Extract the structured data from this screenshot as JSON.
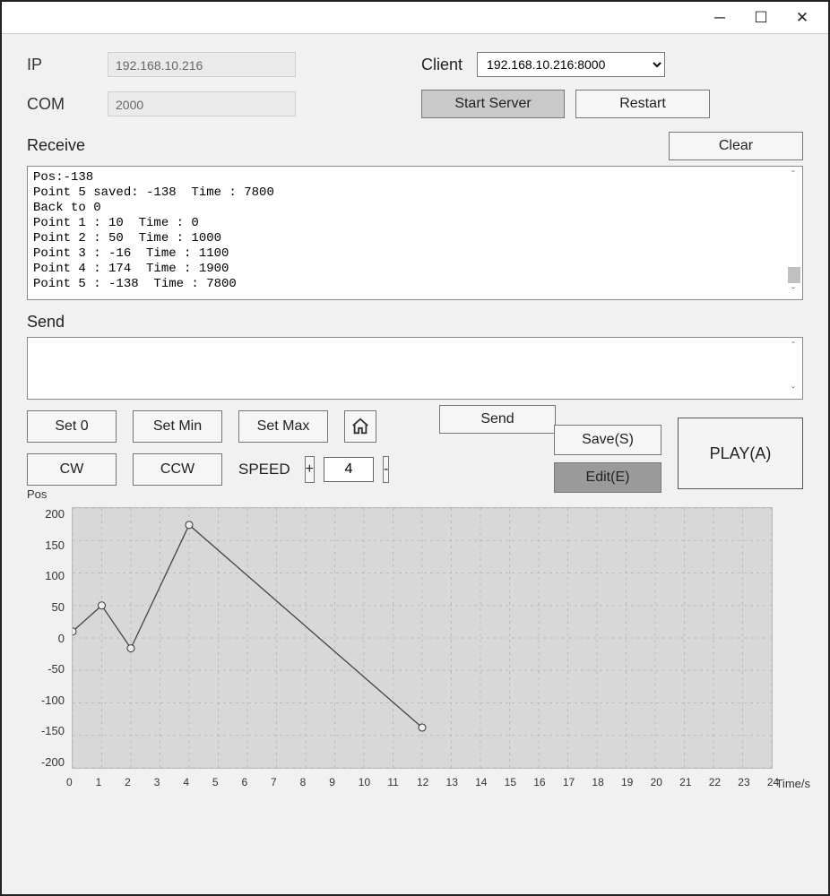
{
  "labels": {
    "ip": "IP",
    "com": "COM",
    "client": "Client",
    "receive": "Receive",
    "send_section": "Send",
    "speed": "SPEED"
  },
  "fields": {
    "ip_value": "192.168.10.216",
    "com_value": "2000",
    "client_selected": "192.168.10.216:8000",
    "speed_value": "4"
  },
  "buttons": {
    "start_server": "Start Server",
    "restart": "Restart",
    "clear": "Clear",
    "send": "Send",
    "set0": "Set 0",
    "set_min": "Set Min",
    "set_max": "Set Max",
    "cw": "CW",
    "ccw": "CCW",
    "plus": "+",
    "minus": "-",
    "save": "Save(S)",
    "edit": "Edit(E)",
    "play": "PLAY(A)"
  },
  "receive_text": "Pos:-138\nPoint 5 saved: -138  Time : 7800\nBack to 0\nPoint 1 : 10  Time : 0\nPoint 2 : 50  Time : 1000\nPoint 3 : -16  Time : 1100\nPoint 4 : 174  Time : 1900\nPoint 5 : -138  Time : 7800",
  "send_text": "",
  "chart_data": {
    "type": "line",
    "title": "",
    "xlabel": "Time/s",
    "ylabel": "Pos",
    "x": [
      0,
      1,
      1.1,
      1.9,
      7.8
    ],
    "y_series_display_x_approx": [
      0,
      1,
      2,
      4,
      12
    ],
    "values": [
      10,
      50,
      -16,
      174,
      -138
    ],
    "ylim": [
      -200,
      200
    ],
    "xlim": [
      0,
      24
    ],
    "yticks": [
      200,
      150,
      100,
      50,
      0,
      -50,
      -100,
      -150,
      -200
    ],
    "xticks": [
      0,
      1,
      2,
      3,
      4,
      5,
      6,
      7,
      8,
      9,
      10,
      11,
      12,
      13,
      14,
      15,
      16,
      17,
      18,
      19,
      20,
      21,
      22,
      23,
      24
    ],
    "grid": true
  }
}
